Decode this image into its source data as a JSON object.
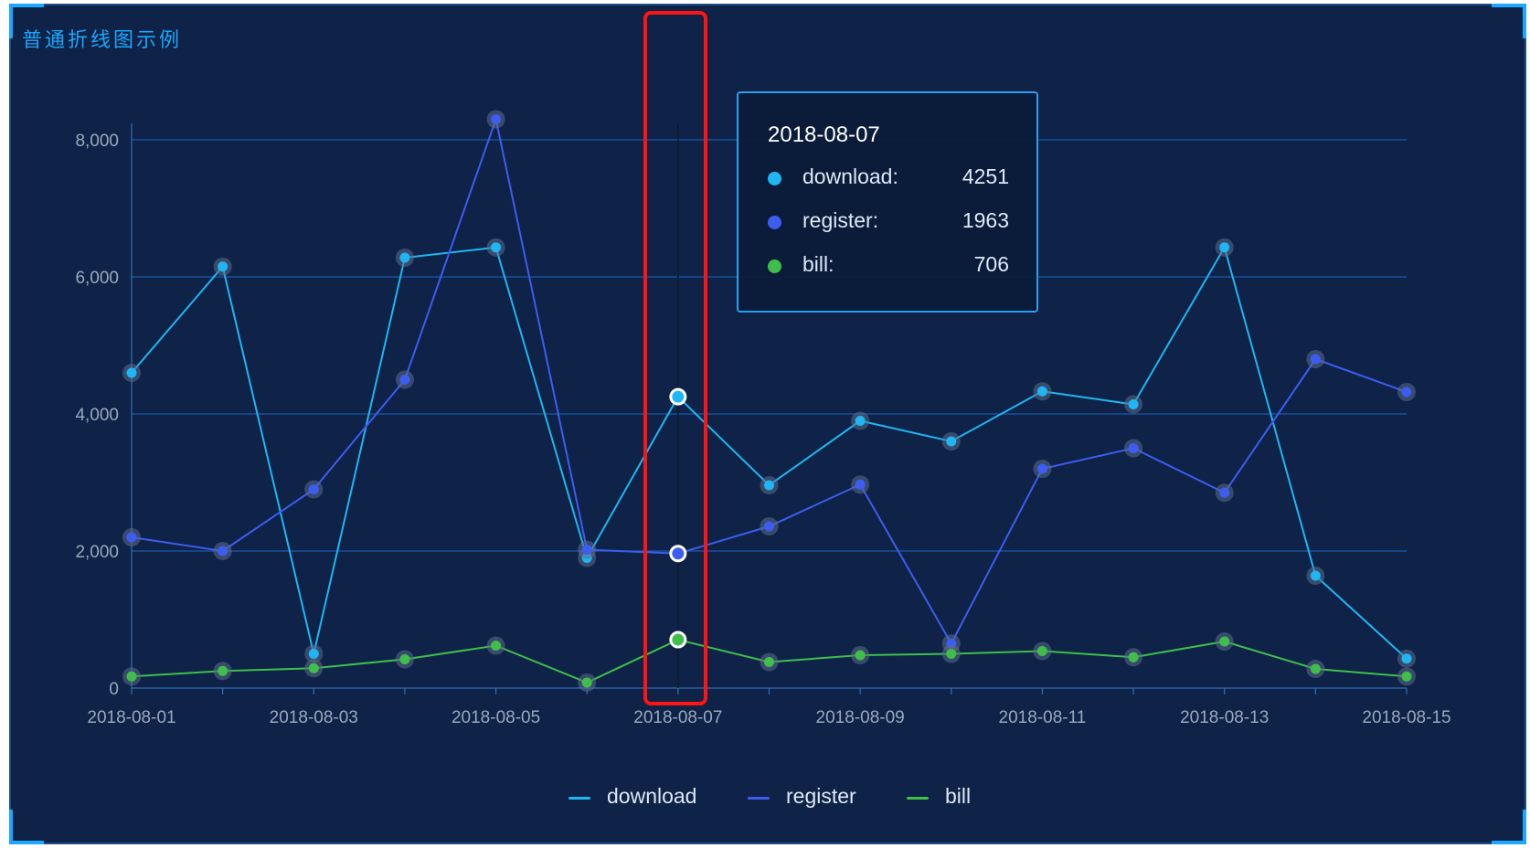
{
  "title": "普通折线图示例",
  "colors": {
    "background": "#0e2347",
    "accent": "#1aa7ff",
    "download": "#1fb6f3",
    "register": "#3d5cf0",
    "bill": "#3fbf4a",
    "grid": "#1a5aa8",
    "axis_text": "#9aa8bd",
    "highlight": "#ff1414"
  },
  "tooltip": {
    "date": "2018-08-07",
    "rows": [
      {
        "name": "download:",
        "value": "4251"
      },
      {
        "name": "register:",
        "value": "1963"
      },
      {
        "name": "bill:",
        "value": "706"
      }
    ]
  },
  "legend": [
    "download",
    "register",
    "bill"
  ],
  "chart_data": {
    "type": "line",
    "x": [
      "2018-08-01",
      "2018-08-02",
      "2018-08-03",
      "2018-08-04",
      "2018-08-05",
      "2018-08-06",
      "2018-08-07",
      "2018-08-08",
      "2018-08-09",
      "2018-08-10",
      "2018-08-11",
      "2018-08-12",
      "2018-08-13",
      "2018-08-14",
      "2018-08-15"
    ],
    "x_tick_labels": [
      "2018-08-01",
      "2018-08-03",
      "2018-08-05",
      "2018-08-07",
      "2018-08-09",
      "2018-08-11",
      "2018-08-13",
      "2018-08-15"
    ],
    "y_tick_labels": [
      "0",
      "2,000",
      "4,000",
      "6,000",
      "8,000"
    ],
    "ylim": [
      0,
      8000
    ],
    "grid": true,
    "legend_position": "bottom-center",
    "highlighted_x": "2018-08-07",
    "series": [
      {
        "name": "download",
        "values": [
          4600,
          6150,
          500,
          6280,
          6430,
          1900,
          4251,
          2960,
          3900,
          3600,
          4330,
          4140,
          6430,
          1640,
          430
        ]
      },
      {
        "name": "register",
        "values": [
          2200,
          2000,
          2900,
          4500,
          8300,
          2020,
          1963,
          2360,
          2970,
          650,
          3200,
          3500,
          2850,
          4800,
          4320
        ]
      },
      {
        "name": "bill",
        "values": [
          170,
          250,
          290,
          420,
          620,
          80,
          706,
          380,
          480,
          500,
          540,
          450,
          680,
          280,
          170
        ]
      }
    ]
  }
}
